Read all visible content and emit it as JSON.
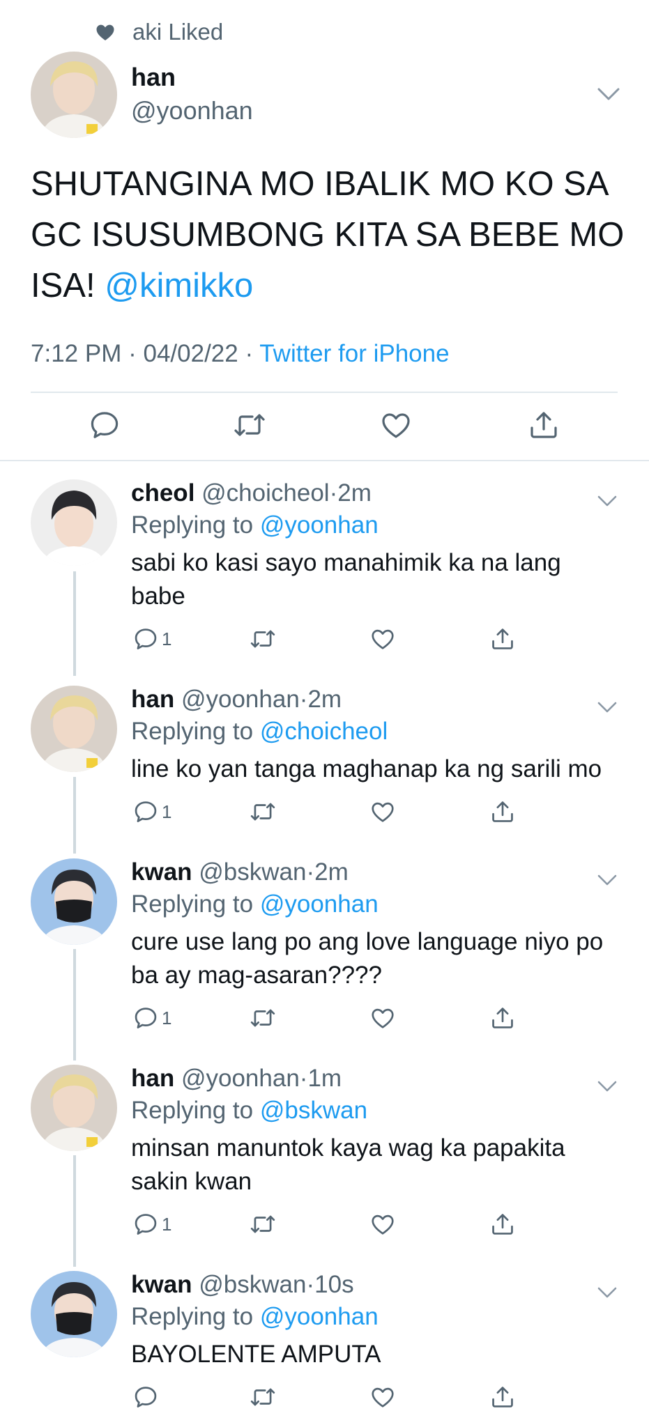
{
  "social_context": {
    "text": "aki Liked",
    "icon": "heart-filled-icon"
  },
  "main_tweet": {
    "name": "han",
    "handle": "@yoonhan",
    "text": "SHUTANGINA MO IBALIK MO KO SA GC ISUSUMBONG KITA SA BEBE MO ISA! ",
    "mention": "@kimikko",
    "time": "7:12 PM",
    "date": "04/02/22",
    "separator": "·",
    "source": "Twitter for iPhone",
    "actions": [
      "reply-icon",
      "retweet-icon",
      "like-icon",
      "share-icon"
    ]
  },
  "replies": [
    {
      "name": "cheol",
      "handle": "@choicheol",
      "time": "2m",
      "replying_label": "Replying to",
      "replying_to": "@yoonhan",
      "text": "sabi ko kasi sayo manahimik ka na lang babe",
      "reply_count": "1"
    },
    {
      "name": "han",
      "handle": "@yoonhan",
      "time": "2m",
      "replying_label": "Replying to",
      "replying_to": "@choicheol",
      "text": "line ko yan tanga maghanap ka ng sarili mo",
      "reply_count": "1"
    },
    {
      "name": "kwan",
      "handle": "@bskwan",
      "time": "2m",
      "replying_label": "Replying to",
      "replying_to": "@yoonhan",
      "text": "cure use lang po ang love language niyo po ba ay mag-asaran????",
      "reply_count": "1"
    },
    {
      "name": "han",
      "handle": "@yoonhan",
      "time": "1m",
      "replying_label": "Replying to",
      "replying_to": "@bskwan",
      "text": "minsan manuntok kaya wag ka papakita sakin kwan",
      "reply_count": "1"
    },
    {
      "name": "kwan",
      "handle": "@bskwan",
      "time": "10s",
      "replying_label": "Replying to",
      "replying_to": "@yoonhan",
      "text": "BAYOLENTE AMPUTA",
      "reply_count": ""
    }
  ],
  "colors": {
    "accent": "#1d9bf0",
    "secondary_text": "#536471",
    "divider": "#e1e8ed",
    "thread_line": "#cfd9de"
  }
}
